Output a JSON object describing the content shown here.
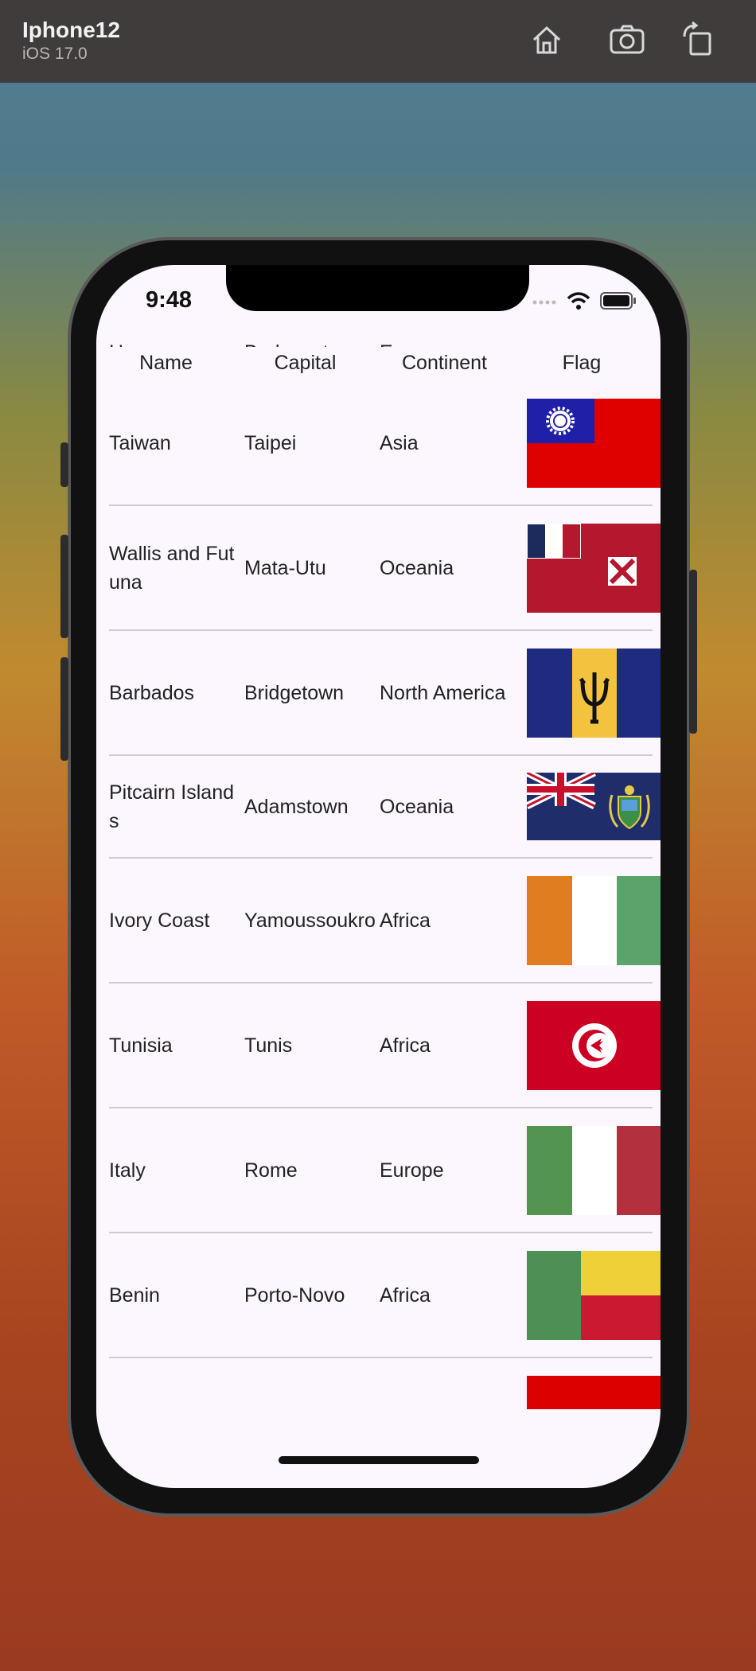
{
  "simulator": {
    "device_name": "Iphone12",
    "os_version": "iOS 17.0",
    "toolbar_icons": [
      "home-icon",
      "screenshot-icon",
      "rotate-icon"
    ]
  },
  "status_bar": {
    "time": "9:48",
    "icons": [
      "signal-icon",
      "wifi-icon",
      "battery-icon"
    ]
  },
  "table": {
    "columns": [
      "Name",
      "Capital",
      "Continent",
      "Flag"
    ],
    "partial_top_row": {
      "name": "Hungary",
      "capital": "Budapest",
      "continent": "Europe"
    },
    "rows": [
      {
        "name": "Taiwan",
        "capital": "Taipei",
        "continent": "Asia",
        "flag": "taiwan-flag"
      },
      {
        "name": "Wallis and Futuna",
        "capital": "Mata-Utu",
        "continent": "Oceania",
        "flag": "wallis-futuna-flag"
      },
      {
        "name": "Barbados",
        "capital": "Bridgetown",
        "continent": "North America",
        "flag": "barbados-flag"
      },
      {
        "name": "Pitcairn Islands",
        "capital": "Adamstown",
        "continent": "Oceania",
        "flag": "pitcairn-flag"
      },
      {
        "name": "Ivory Coast",
        "capital": "Yamoussoukro",
        "continent": "Africa",
        "flag": "ivory-coast-flag"
      },
      {
        "name": "Tunisia",
        "capital": "Tunis",
        "continent": "Africa",
        "flag": "tunisia-flag"
      },
      {
        "name": "Italy",
        "capital": "Rome",
        "continent": "Europe",
        "flag": "italy-flag"
      },
      {
        "name": "Benin",
        "capital": "Porto-Novo",
        "continent": "Africa",
        "flag": "benin-flag"
      }
    ]
  },
  "colors": {
    "screen_background": "#fcf6fe",
    "divider": "#cfcbcf",
    "simulator_bar": "#3f3c3b"
  }
}
